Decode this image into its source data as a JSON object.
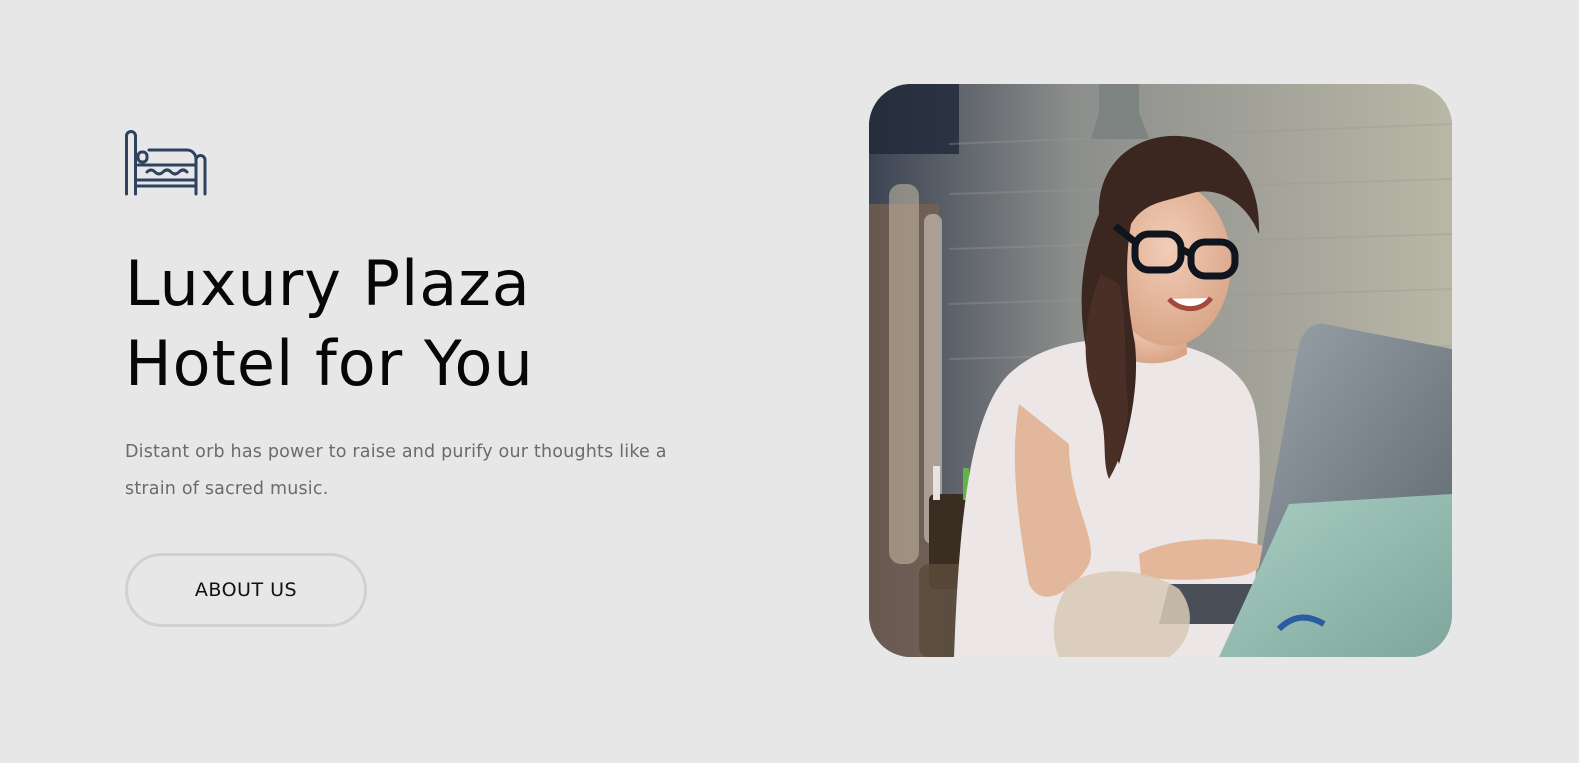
{
  "hero": {
    "icon": "bed-icon",
    "title_line1": "Luxury Plaza",
    "title_line2": "Hotel for You",
    "description": "Distant orb has power to raise and purify our thoughts like a strain of sacred music.",
    "cta_label": "ABOUT US"
  },
  "photo": {
    "subject": "woman with glasses smiling while typing on a laptop"
  },
  "colors": {
    "background": "#e7e7e7",
    "icon": "#2e4260",
    "title": "#070707",
    "body_text": "#6b6b6b",
    "button_border": "#d1d1d1"
  }
}
